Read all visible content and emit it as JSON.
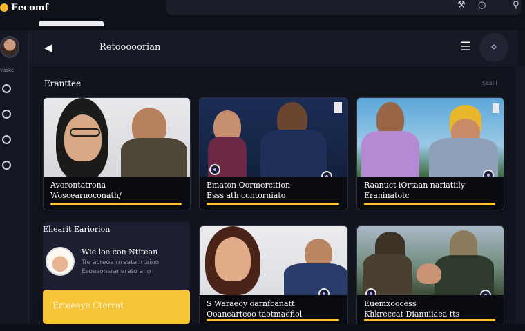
{
  "app": {
    "brand": "Eecomf"
  },
  "topbar": {
    "icons": [
      "tools-icon",
      "circle-icon",
      "user-icon"
    ],
    "icon_glyphs": [
      "⚒",
      "○",
      "⚲"
    ]
  },
  "sidebar": {
    "avatar_label": "vaskc",
    "items": [
      "ring-1",
      "ring-2",
      "ring-3",
      "ring-4"
    ]
  },
  "header": {
    "title": "Retooooorian",
    "back_glyph": "◀",
    "menu_glyph": "☰",
    "sparkle_glyph": "✧"
  },
  "sections": {
    "featured_title": "Eranttee",
    "see_all": "Seaill",
    "panel_title": "Ehearit Eariorion"
  },
  "cards": [
    {
      "line1": "Avorontatrona",
      "line2": "Woscearnoconath/",
      "progress": 0.95
    },
    {
      "line1": "Ematon Oormercition",
      "line2": "Esss ath contorniato",
      "progress": 0.95
    },
    {
      "line1": "Raanuct iOrtaan nariatiily",
      "line2": "Eraninatotc",
      "progress": 0.95
    },
    {
      "line1": "S Waraeoy oarnfcanatt",
      "line2": "Ooanearteoo taotmaefiol",
      "progress": 0.95
    },
    {
      "line1": "Euemxoocess",
      "line2": "Khkreccat Dianuiiaea tts",
      "progress": 0.95
    }
  ],
  "panel": {
    "name": "Wie loe con Ntitean",
    "sub1": "Tre acreoa rrreata Irtaino",
    "sub2": "Esoesonsranerato ano",
    "cta": "Erteeaye Cterrat"
  },
  "colors": {
    "accent": "#f6c437",
    "background": "#12141d",
    "panel": "#1b1f2f"
  }
}
